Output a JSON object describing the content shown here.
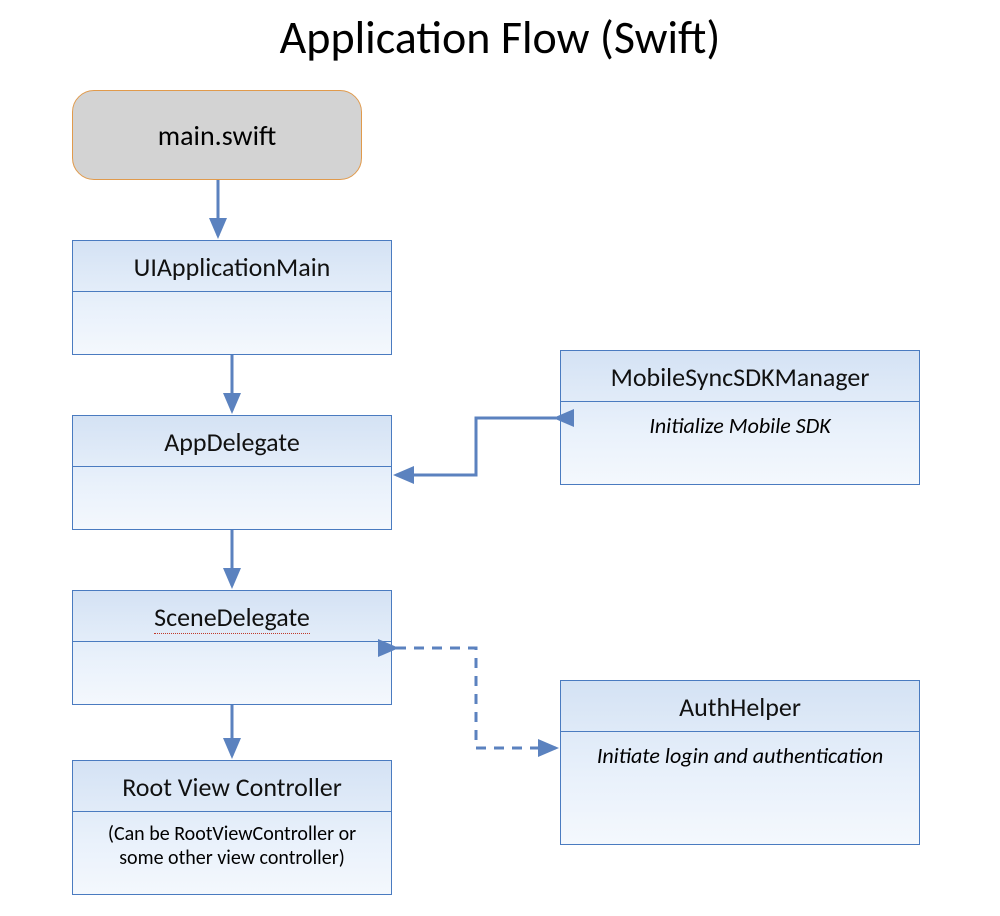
{
  "title": "Application Flow (Swift)",
  "nodes": {
    "start": {
      "label": "main.swift"
    },
    "uiAppMain": {
      "title": "UIApplicationMain",
      "body": ""
    },
    "appDelegate": {
      "title": "AppDelegate",
      "body": ""
    },
    "sceneDelegate": {
      "title": "SceneDelegate",
      "body": ""
    },
    "rootVC": {
      "title": "Root View Controller",
      "body": "(Can be RootViewController or some other view controller)"
    },
    "sdkManager": {
      "title": "MobileSyncSDKManager",
      "body": "Initialize Mobile SDK"
    },
    "authHelper": {
      "title": "AuthHelper",
      "body": "Initiate login and authentication"
    }
  },
  "arrows": {
    "start_to_uiAppMain": "solid",
    "uiAppMain_to_appDelegate": "solid",
    "appDelegate_to_sceneDelegate": "solid",
    "sceneDelegate_to_rootVC": "solid",
    "appDelegate_bidi_sdkManager": "solid-bidirectional",
    "sceneDelegate_bidi_authHelper": "dashed-bidirectional"
  },
  "colors": {
    "node_border": "#4a7bc0",
    "node_fill_top": "#d4e2f4",
    "node_fill_bottom": "#f4f8fd",
    "start_border": "#e09a4c",
    "start_fill": "#d3d3d3",
    "arrow": "#5b82bf"
  }
}
